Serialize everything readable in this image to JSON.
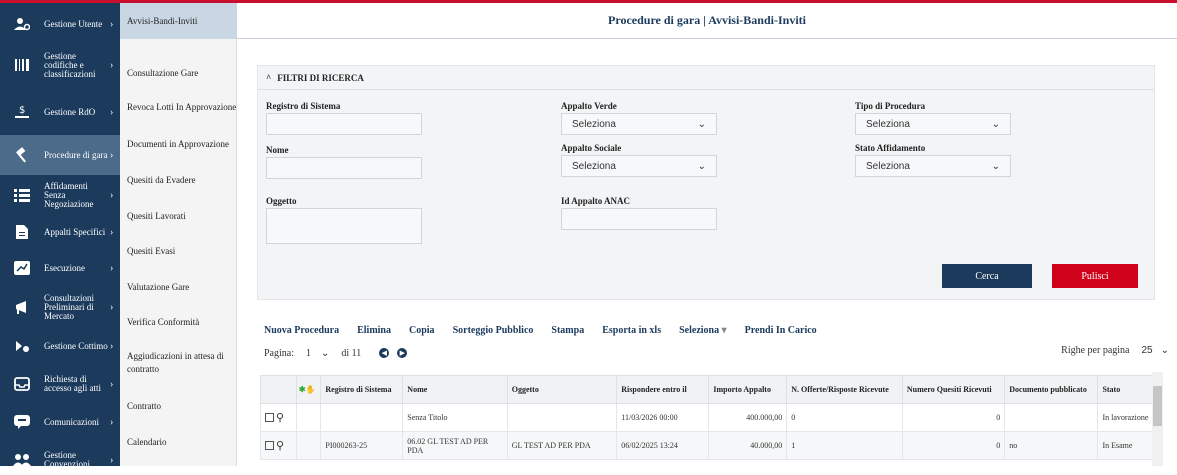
{
  "sidebar": {
    "items": [
      {
        "label": "Gestione Utente",
        "icon": "users-gear-icon"
      },
      {
        "label": "Gestione codifiche e classificazioni",
        "icon": "barcode-icon"
      },
      {
        "label": "Gestione RdO",
        "icon": "hand-dollar-icon"
      },
      {
        "label": "Procedure di gara",
        "icon": "gavel-icon"
      },
      {
        "label": "Affidamenti Senza Negoziazione",
        "icon": "list-icon"
      },
      {
        "label": "Appalti Specifici",
        "icon": "document-icon"
      },
      {
        "label": "Esecuzione",
        "icon": "chart-icon"
      },
      {
        "label": "Consultazioni Preliminari di Mercato",
        "icon": "megaphone-icon"
      },
      {
        "label": "Gestione Cottimo",
        "icon": "contract-icon"
      },
      {
        "label": "Richiesta di accesso agli atti",
        "icon": "inbox-icon"
      },
      {
        "label": "Comunicazioni",
        "icon": "chat-icon"
      },
      {
        "label": "Gestione Convenzioni",
        "icon": "group-icon"
      }
    ]
  },
  "submenu": {
    "items": [
      "Avvisi-Bandi-Inviti",
      "Consultazione Gare",
      "Revoca Lotti In Approvazione",
      "Documenti in Approvazione",
      "Quesiti da Evadere",
      "Quesiti Lavorati",
      "Quesiti Evasi",
      "Valutazione Gare",
      "Verifica Conformità",
      "Aggiudicazioni in attesa di contratto",
      "Contratto",
      "Calendario"
    ]
  },
  "page": {
    "title": "Procedure di gara | Avvisi-Bandi-Inviti"
  },
  "filters": {
    "header": "FILTRI DI RICERCA",
    "registro_label": "Registro di Sistema",
    "nome_label": "Nome",
    "oggetto_label": "Oggetto",
    "appalto_verde_label": "Appalto Verde",
    "appalto_verde_value": "Seleziona",
    "appalto_sociale_label": "Appalto Sociale",
    "appalto_sociale_value": "Seleziona",
    "id_anac_label": "Id Appalto ANAC",
    "tipo_procedura_label": "Tipo di Procedura",
    "tipo_procedura_value": "Seleziona",
    "stato_affidamento_label": "Stato Affidamento",
    "stato_affidamento_value": "Seleziona",
    "cerca": "Cerca",
    "pulisci": "Pulisci"
  },
  "toolbar": {
    "nuova": "Nuova Procedura",
    "elimina": "Elimina",
    "copia": "Copia",
    "sorteggio": "Sorteggio Pubblico",
    "stampa": "Stampa",
    "esporta": "Esporta in xls",
    "seleziona": "Seleziona",
    "prendi": "Prendi In Carico"
  },
  "pager": {
    "label": "Pagina:",
    "current": "1",
    "total": "di 11",
    "rows_label": "Righe per pagina",
    "rows_value": "25"
  },
  "table": {
    "headers": [
      "Registro di Sistema",
      "Nome",
      "Oggetto",
      "Rispondere entro il",
      "Importo Appalto",
      "N. Offerte/Risposte Ricevute",
      "Numero Quesiti Ricevuti",
      "Documento pubblicato",
      "Stato"
    ],
    "rows": [
      [
        "",
        "Senza Titolo",
        "",
        "11/03/2026 00:00",
        "400.000,00",
        "0",
        "0",
        "",
        "In lavorazione"
      ],
      [
        "PI000263-25",
        "06.02 GL TEST AD PER PDA",
        "GL TEST AD PER PDA",
        "06/02/2025 13:24",
        "40.000,00",
        "1",
        "0",
        "no",
        "In Esame"
      ]
    ]
  },
  "colors": {
    "nav_bg": "#1b3a5c",
    "accent_red": "#c8102e",
    "cerca_bg": "#1b3a5c",
    "pulisci_bg": "#d0021b"
  }
}
